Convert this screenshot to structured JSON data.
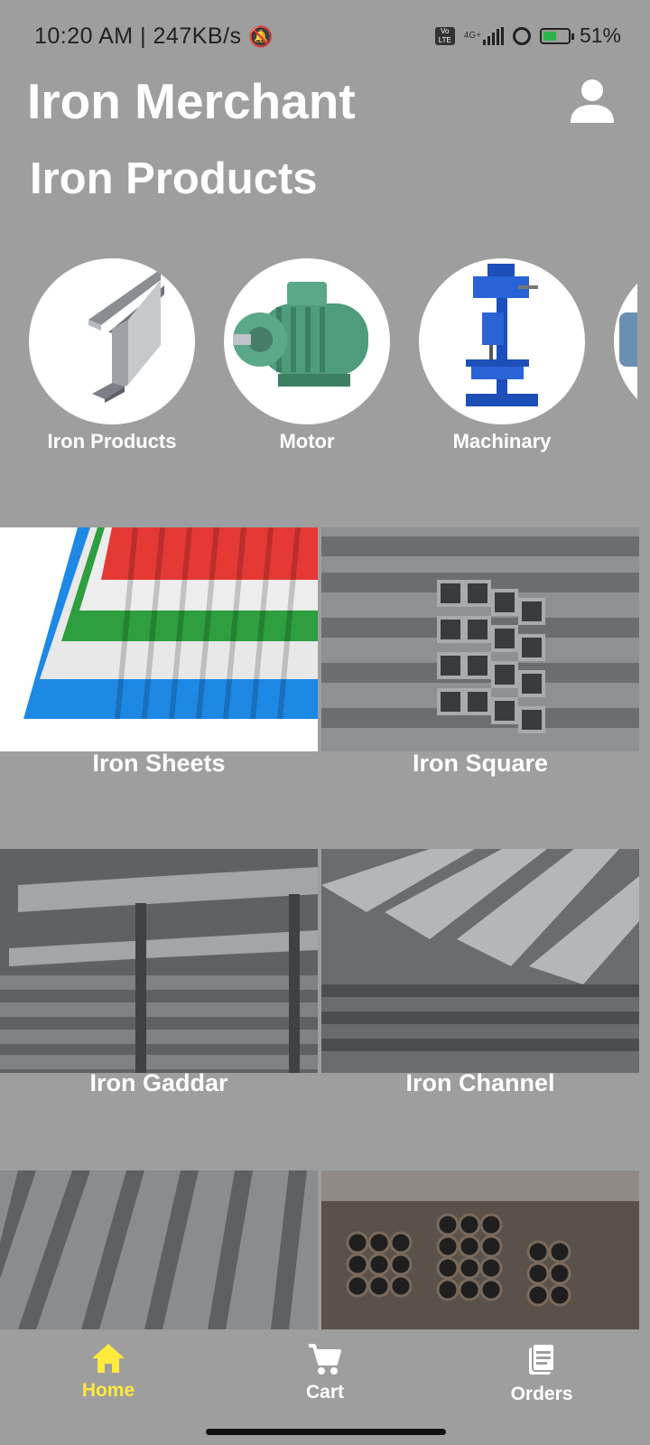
{
  "status_bar": {
    "time_speed": "10:20 AM | 247KB/s",
    "network_label": "Vo LTE",
    "network_type": "4G+",
    "battery_percent": "51%"
  },
  "header": {
    "title": "Iron Merchant",
    "section_title": "Iron Products"
  },
  "categories": [
    {
      "label": "Iron Products",
      "icon": "i-beam"
    },
    {
      "label": "Motor",
      "icon": "electric-motor"
    },
    {
      "label": "Machinary",
      "icon": "drill-press"
    }
  ],
  "products": [
    {
      "label": "Iron Sheets",
      "image": "corrugated-sheets"
    },
    {
      "label": "Iron Square",
      "image": "square-tubes"
    },
    {
      "label": "Iron Gaddar",
      "image": "i-beams-stack"
    },
    {
      "label": "Iron Channel",
      "image": "channels"
    },
    {
      "label": "",
      "image": "angles"
    },
    {
      "label": "",
      "image": "round-pipes"
    }
  ],
  "bottom_nav": {
    "items": [
      {
        "label": "Home",
        "icon": "home-icon",
        "active": true
      },
      {
        "label": "Cart",
        "icon": "cart-icon",
        "active": false
      },
      {
        "label": "Orders",
        "icon": "orders-icon",
        "active": false
      }
    ]
  },
  "colors": {
    "background": "#9e9e9e",
    "active_nav": "#ffeb3b",
    "text": "#ffffff"
  }
}
